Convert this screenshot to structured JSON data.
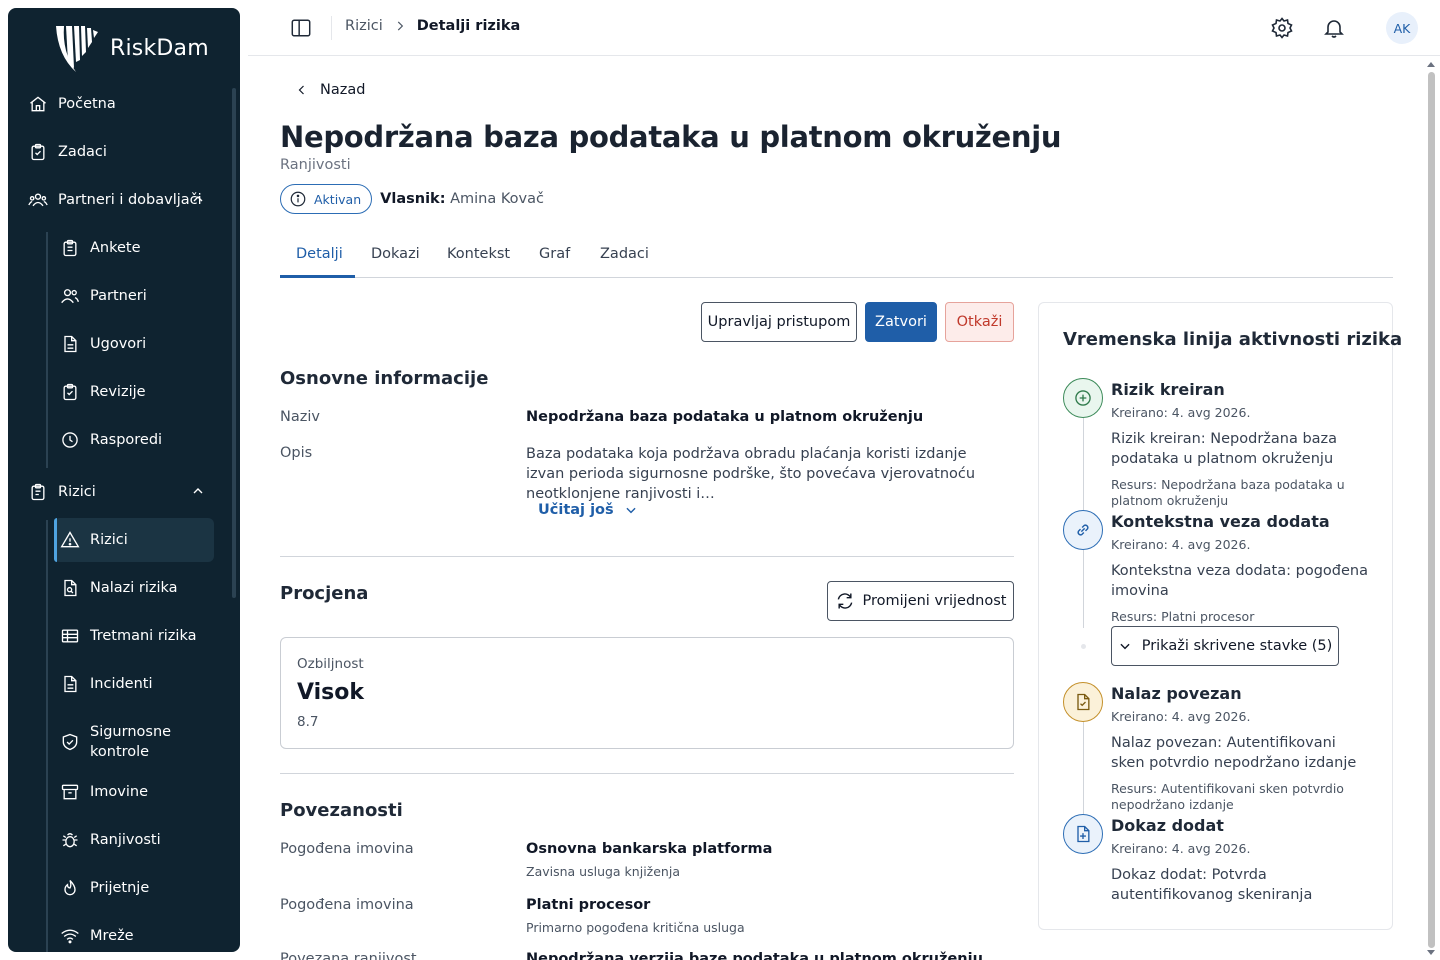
{
  "app": {
    "name": "RiskDam"
  },
  "sidebar": {
    "items": [
      {
        "label": "Početna"
      },
      {
        "label": "Zadaci"
      },
      {
        "label": "Partneri i dobavljači"
      },
      {
        "label": "Ankete"
      },
      {
        "label": "Partneri"
      },
      {
        "label": "Ugovori"
      },
      {
        "label": "Revizije"
      },
      {
        "label": "Rasporedi"
      },
      {
        "label": "Rizici"
      },
      {
        "label": "Rizici"
      },
      {
        "label": "Nalazi rizika"
      },
      {
        "label": "Tretmani rizika"
      },
      {
        "label": "Incidenti"
      },
      {
        "label": "Sigurnosne kontrole"
      },
      {
        "label": "Imovine"
      },
      {
        "label": "Ranjivosti"
      },
      {
        "label": "Prijetnje"
      },
      {
        "label": "Mreže"
      }
    ]
  },
  "topbar": {
    "breadcrumb": [
      "Rizici",
      "Detalji rizika"
    ],
    "avatar_initials": "AK"
  },
  "page": {
    "back_label": "Nazad",
    "title": "Nepodržana baza podataka u platnom okruženju",
    "subtitle": "Ranjivosti",
    "status": "Aktivan",
    "owner_label": "Vlasnik:",
    "owner_value": "Amina Kovač"
  },
  "tabs": [
    "Detalji",
    "Dokazi",
    "Kontekst",
    "Graf",
    "Zadaci"
  ],
  "actions": {
    "manage_access": "Upravljaj pristupom",
    "close": "Zatvori",
    "cancel": "Otkaži"
  },
  "basic_info": {
    "title": "Osnovne informacije",
    "name_label": "Naziv",
    "name_value": "Nepodržana baza podataka u platnom okruženju",
    "desc_label": "Opis",
    "desc_value": "Baza podataka koja podržava obradu plaćanja koristi izdanje izvan perioda sigurnosne podrške, što povećava vjerovatnoću neotklonjene ranjivosti i…",
    "load_more": "Učitaj još"
  },
  "assessment": {
    "title": "Procjena",
    "change_button": "Promijeni vrijednost",
    "severity_label": "Ozbiljnost",
    "severity_value": "Visok",
    "severity_score": "8.7"
  },
  "relations": {
    "title": "Povezanosti",
    "items": [
      {
        "label": "Pogođena imovina",
        "value": "Osnovna bankarska platforma",
        "note": "Zavisna usluga knjiženja"
      },
      {
        "label": "Pogođena imovina",
        "value": "Platni procesor",
        "note": "Primarno pogođena kritična usluga"
      },
      {
        "label": "Povezana ranjivost",
        "value": "Nepodržana verzija baze podataka u platnom okruženju"
      }
    ]
  },
  "timeline": {
    "title": "Vremenska linija aktivnosti rizika",
    "events": [
      {
        "title": "Rizik kreiran",
        "date": "Kreirano: 4. avg 2026.",
        "body": "Rizik kreiran: Nepodržana baza podataka u platnom okruženju",
        "resource": "Resurs: Nepodržana baza podataka u platnom okruženju",
        "color": "#3d8b5a",
        "icon": "plus-circle-icon"
      },
      {
        "title": "Kontekstna veza dodata",
        "date": "Kreirano: 4. avg 2026.",
        "body": "Kontekstna veza dodata: pogođena imovina",
        "resource": "Resurs: Platni procesor",
        "color": "#2c6db5",
        "icon": "link-icon"
      },
      {
        "title": "Nalaz povezan",
        "date": "Kreirano: 4. avg 2026.",
        "body": "Nalaz povezan: Autentifikovani sken potvrdio nepodržano izdanje",
        "resource": "Resurs: Autentifikovani sken potvrdio nepodržano izdanje",
        "color": "#c4902a",
        "icon": "document-check-icon"
      },
      {
        "title": "Dokaz dodat",
        "date": "Kreirano: 4. avg 2026.",
        "body": "Dokaz dodat: Potvrda autentifikovanog skeniranja",
        "color": "#2c6db5",
        "icon": "document-plus-icon"
      }
    ],
    "show_hidden": "Prikaži skrivene stavke (5)"
  },
  "colors": {
    "sidebar_bg": "#0f2330",
    "accent": "#1f5ea8",
    "danger": "#c0392b"
  }
}
